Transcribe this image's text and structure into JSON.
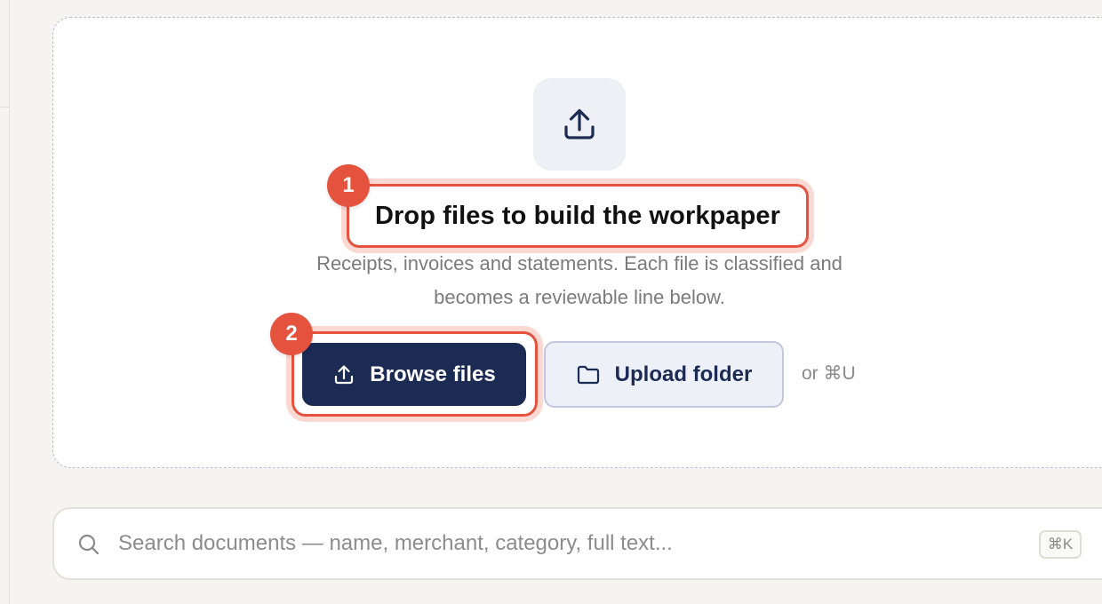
{
  "dropzone": {
    "title": "Drop files to build the workpaper",
    "subtitle_line1": "Receipts, invoices and statements. Each file is classified and",
    "subtitle_line2": "becomes a reviewable line below.",
    "upload_icon": "upload-icon",
    "browse_label": "Browse files",
    "browse_icon": "upload-icon",
    "folder_label": "Upload folder",
    "folder_icon": "folder-icon",
    "shortcut_hint": "or ⌘U"
  },
  "annotations": [
    {
      "label": "1",
      "target": "dropzone-title"
    },
    {
      "label": "2",
      "target": "browse-files-button"
    }
  ],
  "search": {
    "placeholder": "Search documents — name, merchant, category, full text...",
    "value": "",
    "shortcut": "⌘K",
    "icon": "search-icon"
  },
  "colors": {
    "primary": "#1c2b54",
    "annotation": "#e5533f",
    "background": "#f5f4f0"
  }
}
